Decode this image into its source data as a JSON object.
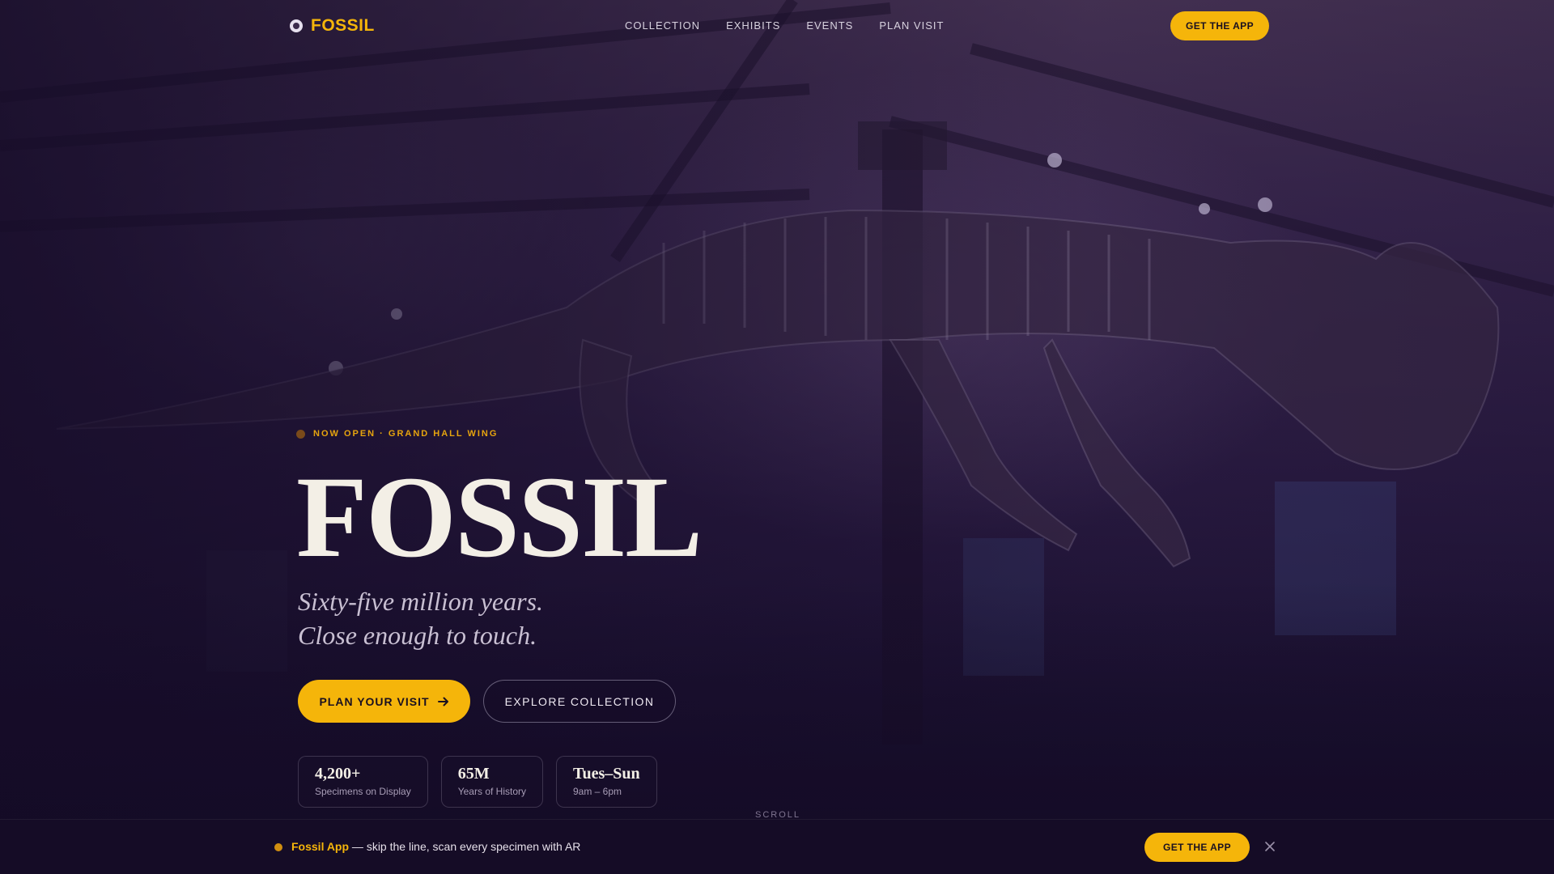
{
  "brand": {
    "name": "FOSSIL"
  },
  "nav": {
    "links": [
      "COLLECTION",
      "EXHIBITS",
      "EVENTS",
      "PLAN VISIT"
    ],
    "cta": "GET THE APP"
  },
  "hero": {
    "eyebrow": "NOW OPEN · GRAND HALL WING",
    "title": "FOSSIL",
    "tagline_line1": "Sixty-five million years.",
    "tagline_line2": "Close enough to touch.",
    "primary_cta": "PLAN YOUR VISIT",
    "secondary_cta": "EXPLORE COLLECTION",
    "stats": [
      {
        "value": "4,200+",
        "label": "Specimens on Display"
      },
      {
        "value": "65M",
        "label": "Years of History"
      },
      {
        "value": "Tues–Sun",
        "label": "9am – 6pm"
      }
    ],
    "scroll_hint": "SCROLL"
  },
  "banner": {
    "app_name": "Fossil App",
    "message": " — skip the line, scan every specimen with AR",
    "cta": "GET THE APP",
    "close_icon": "close-icon"
  },
  "colors": {
    "accent": "#f5b50a",
    "background": "#1a0f2b",
    "title": "#f3efe6"
  }
}
